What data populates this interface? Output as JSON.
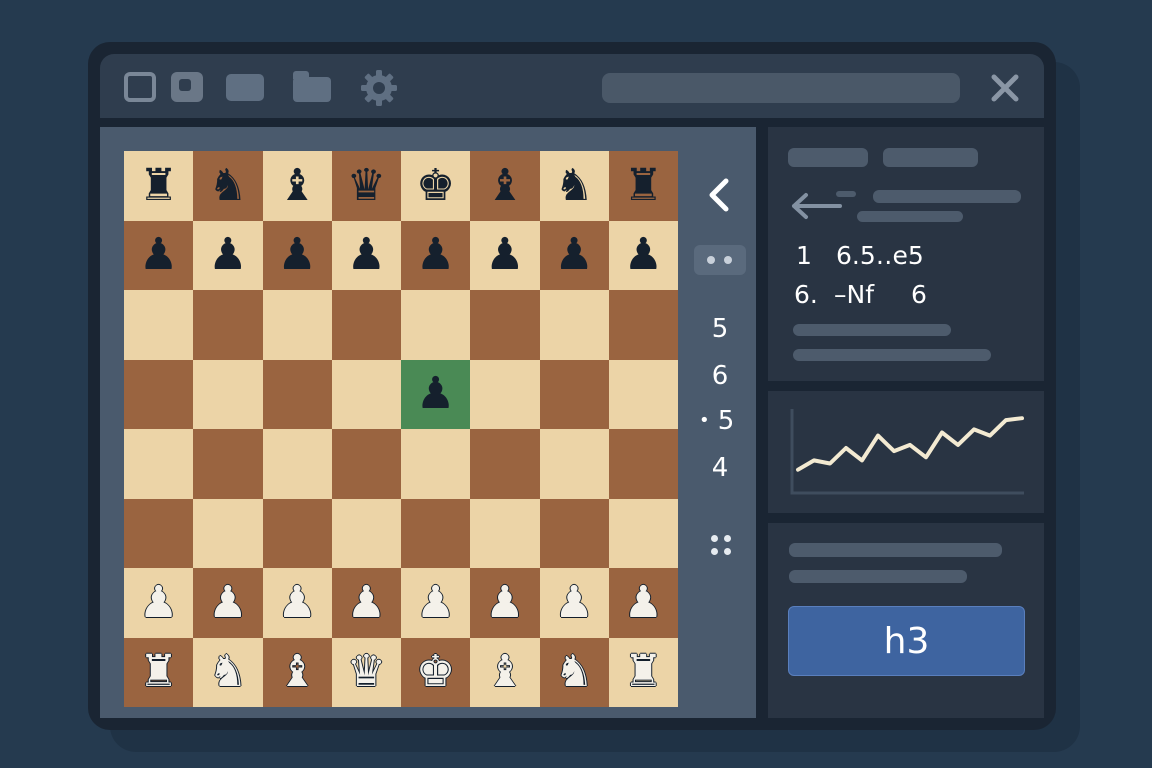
{
  "toolbar": {
    "icons": [
      "window-outline-icon",
      "window-filled-icon",
      "panel-icon",
      "folder-icon",
      "gear-icon"
    ],
    "close_icon": "close-icon"
  },
  "board": {
    "light_color": "#ecd4a7",
    "dark_color": "#9a6440",
    "highlight_color": "#4a8a55",
    "highlight_square": "e5",
    "ranks": [
      [
        "r",
        "n",
        "b",
        "q",
        "k",
        "b",
        "n",
        "r"
      ],
      [
        "p",
        "p",
        "p",
        "p",
        "p",
        "p",
        "p",
        "p"
      ],
      [
        "",
        "",
        "",
        "",
        "",
        "",
        "",
        ""
      ],
      [
        "",
        "",
        "",
        "",
        "p",
        "",
        "",
        ""
      ],
      [
        "",
        "",
        "",
        "",
        "",
        "",
        "",
        ""
      ],
      [
        "",
        "",
        "",
        "",
        "",
        "",
        "",
        ""
      ],
      [
        "P",
        "P",
        "P",
        "P",
        "P",
        "P",
        "P",
        "P"
      ],
      [
        "R",
        "N",
        "B",
        "Q",
        "K",
        "B",
        "N",
        "R"
      ]
    ]
  },
  "side_nav": {
    "back_icon": "chevron-left-icon",
    "move_numbers": [
      "5",
      "6",
      "5",
      "4"
    ],
    "current_marker": "•",
    "grid_icon": "dots-grid-icon"
  },
  "notation": {
    "back_arrow_icon": "arrow-left-icon",
    "line1_num": "1",
    "line1_move": "6.5‥e5",
    "line2_num": "6.",
    "line2_move": "–Nf",
    "line2_extra": "6"
  },
  "eval_chart": {
    "type": "line",
    "values": [
      0.15,
      0.3,
      0.25,
      0.5,
      0.3,
      0.7,
      0.45,
      0.55,
      0.35,
      0.75,
      0.55,
      0.8,
      0.7,
      0.95,
      0.98
    ],
    "line_color": "#f3ead2"
  },
  "action": {
    "move_button_label": "h3",
    "accent": "#3e64a0"
  }
}
